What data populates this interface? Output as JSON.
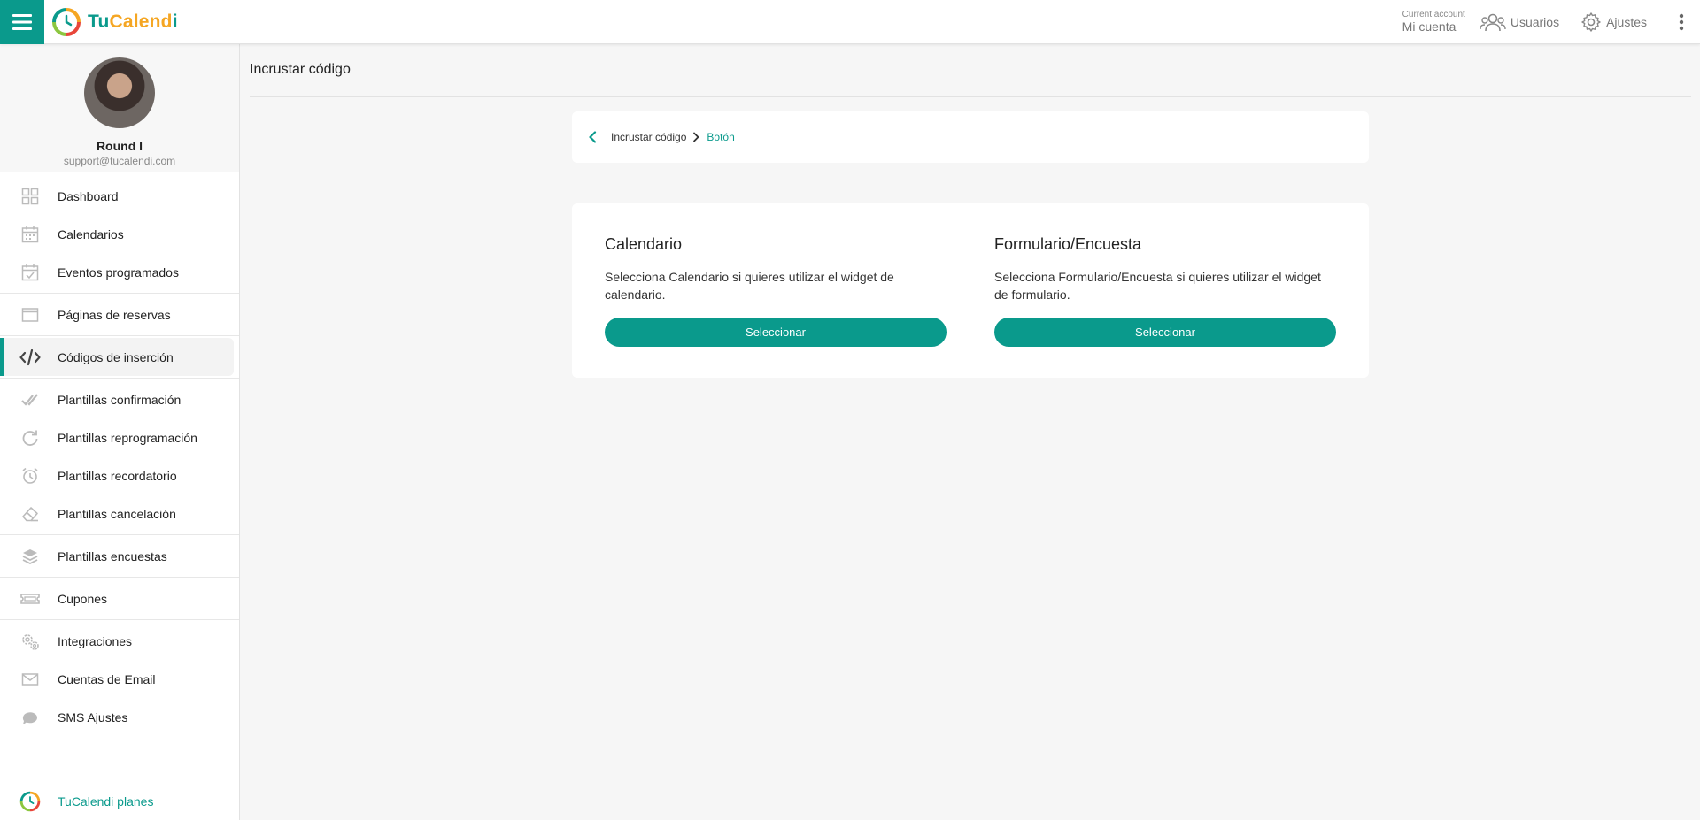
{
  "header": {
    "logo": {
      "part1": "Tu",
      "part2": "Calend",
      "part3": "i"
    },
    "account_small": "Current account",
    "account_big": "Mi cuenta",
    "users_label": "Usuarios",
    "settings_label": "Ajustes",
    "colors": {
      "brand": "#0a9a8c",
      "accent": "#f5a623"
    }
  },
  "profile": {
    "name": "Round I",
    "email": "support@tucalendi.com"
  },
  "sidebar": {
    "items": [
      {
        "label": "Dashboard",
        "icon": "dashboard-icon"
      },
      {
        "label": "Calendarios",
        "icon": "calendar-icon"
      },
      {
        "label": "Eventos programados",
        "icon": "calendar-check-icon"
      },
      {
        "label": "Páginas de reservas",
        "icon": "browser-window-icon"
      },
      {
        "label": "Códigos de inserción",
        "icon": "code-icon",
        "active": true
      },
      {
        "label": "Plantillas confirmación",
        "icon": "double-check-icon"
      },
      {
        "label": "Plantillas reprogramación",
        "icon": "redo-icon"
      },
      {
        "label": "Plantillas recordatorio",
        "icon": "alarm-clock-icon"
      },
      {
        "label": "Plantillas cancelación",
        "icon": "eraser-icon"
      },
      {
        "label": "Plantillas encuestas",
        "icon": "layers-icon"
      },
      {
        "label": "Cupones",
        "icon": "ticket-icon"
      },
      {
        "label": "Integraciones",
        "icon": "gears-icon"
      },
      {
        "label": "Cuentas de Email",
        "icon": "envelope-icon"
      },
      {
        "label": "SMS Ajustes",
        "icon": "sms-icon"
      }
    ],
    "plan_label": "TuCalendi planes"
  },
  "main": {
    "title": "Incrustar código",
    "breadcrumb": {
      "item": "Incrustar código",
      "current": "Botón"
    },
    "choices": [
      {
        "title": "Calendario",
        "description": "Selecciona Calendario si quieres utilizar el widget de calendario.",
        "button": "Seleccionar"
      },
      {
        "title": "Formulario/Encuesta",
        "description": "Selecciona Formulario/Encuesta si quieres utilizar el widget de formulario.",
        "button": "Seleccionar"
      }
    ]
  }
}
